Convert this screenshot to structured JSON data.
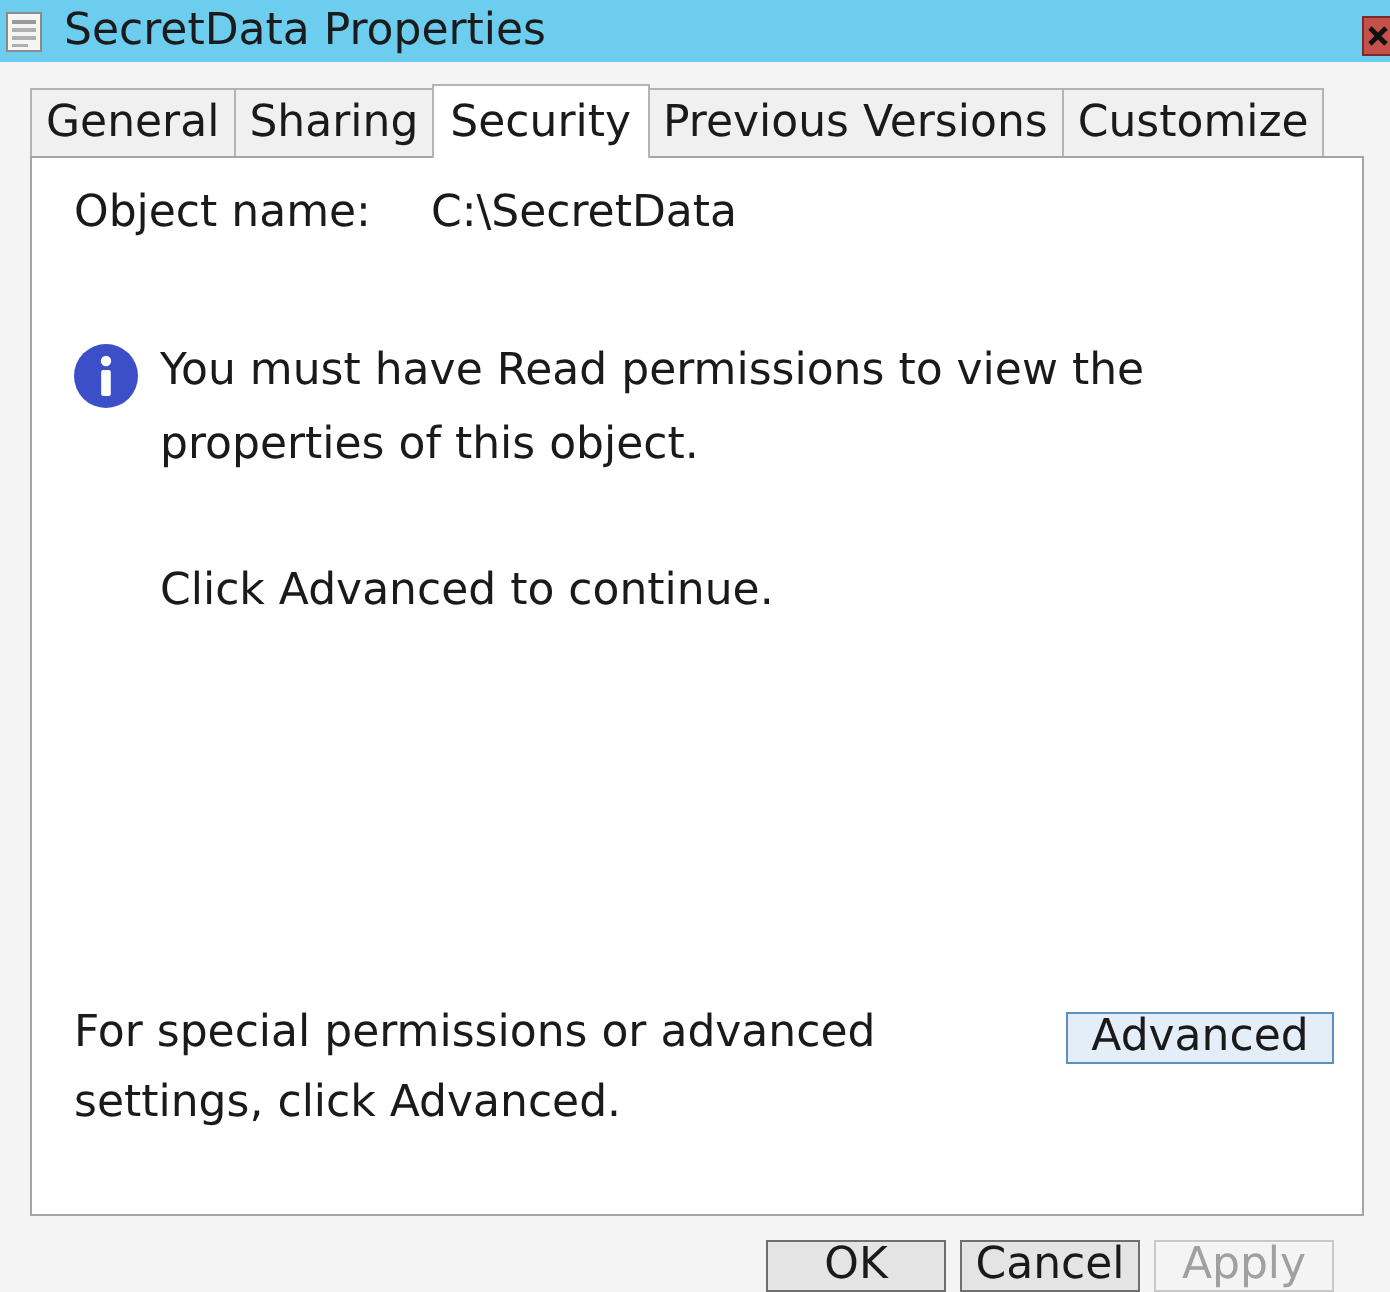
{
  "window": {
    "title": "SecretData Properties"
  },
  "tabs": [
    {
      "label": "General",
      "selected": false
    },
    {
      "label": "Sharing",
      "selected": false
    },
    {
      "label": "Security",
      "selected": true
    },
    {
      "label": "Previous Versions",
      "selected": false
    },
    {
      "label": "Customize",
      "selected": false
    }
  ],
  "object_name": {
    "label": "Object name:",
    "value": "C:\\SecretData"
  },
  "info_message": "You must have Read permissions to view the properties of this object.",
  "continue_note": "Click Advanced to continue.",
  "advanced_hint": "For special permissions or advanced settings, click Advanced.",
  "advanced_button": {
    "label": "Advanced"
  },
  "buttons": [
    {
      "label": "OK",
      "disabled": false
    },
    {
      "label": "Cancel",
      "disabled": false
    },
    {
      "label": "Apply",
      "disabled": true
    }
  ]
}
